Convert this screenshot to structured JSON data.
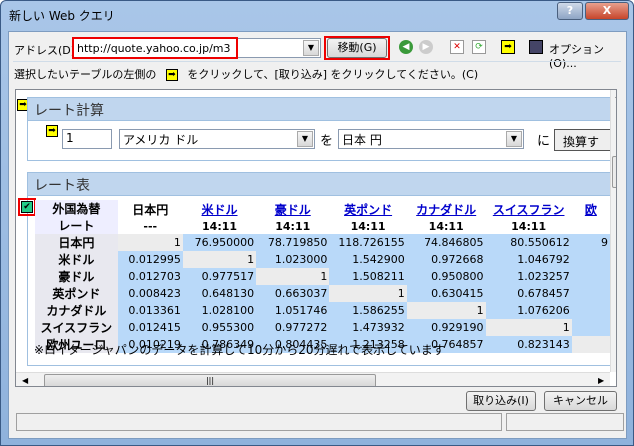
{
  "window": {
    "title": "新しい Web クエリ",
    "help": "?",
    "close": "X"
  },
  "toolbar": {
    "address_label": "アドレス(D):",
    "address_value": "http://quote.yahoo.co.jp/m3",
    "go_label": "移動(G)",
    "options_label": "オプション(O)..."
  },
  "instruction": {
    "before": "選択したいテーブルの左側の",
    "after": "をクリックして、[取り込み] をクリックしてください。(C)"
  },
  "calc": {
    "title": "レート計算",
    "amount": "1",
    "from": "アメリカ ドル",
    "wo": "を",
    "to": "日本 円",
    "ni": "に",
    "convert": "換算す"
  },
  "rate_table": {
    "title": "レート表",
    "corner": [
      "外国為替",
      "レート"
    ],
    "columns": [
      {
        "name": "日本円",
        "time": "---",
        "link": false
      },
      {
        "name": "米ドル",
        "time": "14:11",
        "link": true
      },
      {
        "name": "豪ドル",
        "time": "14:11",
        "link": true
      },
      {
        "name": "英ポンド",
        "time": "14:11",
        "link": true
      },
      {
        "name": "カナダドル",
        "time": "14:11",
        "link": true
      },
      {
        "name": "スイスフラン",
        "time": "14:11",
        "link": true
      },
      {
        "name": "欧",
        "time": "",
        "link": true
      }
    ],
    "rows": [
      {
        "name": "日本円",
        "values": [
          "1",
          "76.950000",
          "78.719850",
          "118.726155",
          "74.846805",
          "80.550612",
          "9"
        ]
      },
      {
        "name": "米ドル",
        "values": [
          "0.012995",
          "1",
          "1.023000",
          "1.542900",
          "0.972668",
          "1.046792",
          ""
        ]
      },
      {
        "name": "豪ドル",
        "values": [
          "0.012703",
          "0.977517",
          "1",
          "1.508211",
          "0.950800",
          "1.023257",
          ""
        ]
      },
      {
        "name": "英ポンド",
        "values": [
          "0.008423",
          "0.648130",
          "0.663037",
          "1",
          "0.630415",
          "0.678457",
          ""
        ]
      },
      {
        "name": "カナダドル",
        "values": [
          "0.013361",
          "1.028100",
          "1.051746",
          "1.586255",
          "1",
          "1.076206",
          ""
        ]
      },
      {
        "name": "スイスフラン",
        "values": [
          "0.012415",
          "0.955300",
          "0.977272",
          "1.473932",
          "0.929190",
          "1",
          ""
        ]
      },
      {
        "name": "欧州ユーロ",
        "values": [
          "0.010219",
          "0.786349",
          "0.804435",
          "1.213258",
          "0.764857",
          "0.823143",
          ""
        ]
      }
    ],
    "note": "※ロイタージャパンのデータを計算して10分から20分遅れで表示しています"
  },
  "buttons": {
    "import": "取り込み(I)",
    "cancel": "キャンセル"
  }
}
